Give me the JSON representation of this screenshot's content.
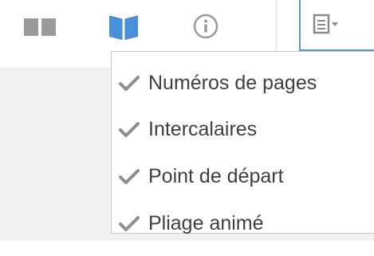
{
  "toolbar": {
    "icons": [
      "double-page-icon",
      "book-icon",
      "info-icon",
      "options-icon"
    ],
    "colors": {
      "icon_gray": "#9b9b9b",
      "book_blue": "#4a8fd9",
      "active_border": "#5b95d6"
    }
  },
  "menu": {
    "items": [
      {
        "label": "Numéros de pages",
        "checked": true
      },
      {
        "label": "Intercalaires",
        "checked": true
      },
      {
        "label": "Point de départ",
        "checked": true
      },
      {
        "label": "Pliage animé",
        "checked": true
      }
    ],
    "check_color": "#8d8d8d",
    "text_color": "#3f3f3f"
  }
}
